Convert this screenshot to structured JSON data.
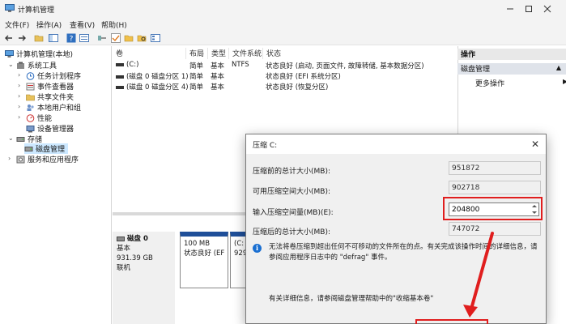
{
  "window": {
    "title": "计算机管理",
    "controls": [
      "minimize",
      "maximize",
      "close"
    ]
  },
  "menu": [
    "文件(F)",
    "操作(A)",
    "查看(V)",
    "帮助(H)"
  ],
  "tree": {
    "root": "计算机管理(本地)",
    "items": [
      {
        "label": "系统工具",
        "icon": "tools-icon"
      },
      {
        "label": "任务计划程序",
        "icon": "clock-icon"
      },
      {
        "label": "事件查看器",
        "icon": "event-viewer-icon"
      },
      {
        "label": "共享文件夹",
        "icon": "shared-folder-icon"
      },
      {
        "label": "本地用户和组",
        "icon": "users-icon"
      },
      {
        "label": "性能",
        "icon": "performance-icon"
      },
      {
        "label": "设备管理器",
        "icon": "device-manager-icon"
      },
      {
        "label": "存储",
        "icon": "storage-icon"
      },
      {
        "label": "磁盘管理",
        "icon": "disk-icon"
      },
      {
        "label": "服务和应用程序",
        "icon": "services-icon"
      }
    ]
  },
  "volume_table": {
    "columns": [
      "卷",
      "布局",
      "类型",
      "文件系统",
      "状态"
    ],
    "rows": [
      {
        "volume": "(C:)",
        "layout": "简单",
        "type": "基本",
        "fs": "NTFS",
        "status": "状态良好 (启动, 页面文件, 故障转储, 基本数据分区)"
      },
      {
        "volume": "(磁盘 0 磁盘分区 1)",
        "layout": "简单",
        "type": "基本",
        "fs": "",
        "status": "状态良好 (EFI 系统分区)"
      },
      {
        "volume": "(磁盘 0 磁盘分区 4)",
        "layout": "简单",
        "type": "基本",
        "fs": "",
        "status": "状态良好 (恢复分区)"
      }
    ]
  },
  "disk": {
    "name": "磁盘 0",
    "kind": "基本",
    "size": "931.39 GB",
    "state": "联机",
    "partitions": [
      {
        "line1": "100 MB",
        "line2": "状态良好 (EFI"
      },
      {
        "line1": "(C:",
        "line2": "929"
      }
    ]
  },
  "actions": {
    "header": "操作",
    "section": "磁盘管理",
    "more": "更多操作"
  },
  "dialog": {
    "title": "压缩 C:",
    "fields": [
      {
        "label": "压缩前的总计大小(MB):",
        "value": "951872"
      },
      {
        "label": "可用压缩空间大小(MB):",
        "value": "902718"
      },
      {
        "label": "输入压缩空间量(MB)(E):",
        "value": "204800"
      },
      {
        "label": "压缩后的总计大小(MB):",
        "value": "747072"
      }
    ],
    "warning": "无法将卷压缩到超出任何不可移动的文件所在的点。有关完成该操作时间的详细信息，请参阅应用程序日志中的 \"defrag\" 事件。",
    "more_info": "有关详细信息，请参阅磁盘管理帮助中的\"收缩基本卷\""
  },
  "colors": {
    "highlight": "#e01e1e",
    "partition_bar": "#1f4f99",
    "selection": "#cce8ff"
  }
}
